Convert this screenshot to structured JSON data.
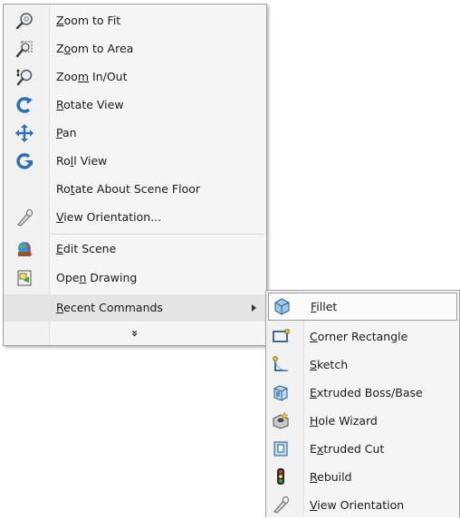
{
  "context_menu": {
    "items": [
      {
        "pre": "",
        "u": "Z",
        "post": "oom to Fit",
        "icon": "zoom-to-fit-icon"
      },
      {
        "pre": "Z",
        "u": "o",
        "post": "om to Area",
        "icon": "zoom-to-area-icon"
      },
      {
        "pre": "Zoo",
        "u": "m",
        "post": " In/Out",
        "icon": "zoom-in-out-icon"
      },
      {
        "pre": "",
        "u": "R",
        "post": "otate View",
        "icon": "rotate-view-icon"
      },
      {
        "pre": "",
        "u": "P",
        "post": "an",
        "icon": "pan-icon"
      },
      {
        "pre": "Ro",
        "u": "l",
        "post": "l View",
        "icon": "roll-view-icon"
      },
      {
        "pre": "Ro",
        "u": "t",
        "post": "ate About Scene Floor",
        "icon": ""
      },
      {
        "pre": "",
        "u": "V",
        "post": "iew Orientation...",
        "icon": "view-orientation-icon"
      },
      {
        "pre": "",
        "u": "E",
        "post": "dit Scene",
        "icon": "edit-scene-icon"
      },
      {
        "pre": "Ope",
        "u": "n",
        "post": " Drawing",
        "icon": "open-drawing-icon"
      },
      {
        "pre": "",
        "u": "R",
        "post": "ecent Commands",
        "icon": ""
      }
    ],
    "more_glyph": "»"
  },
  "submenu": {
    "items": [
      {
        "pre": "",
        "u": "F",
        "post": "illet",
        "icon": "fillet-icon"
      },
      {
        "pre": "",
        "u": "C",
        "post": "orner Rectangle",
        "icon": "corner-rectangle-icon"
      },
      {
        "pre": "",
        "u": "S",
        "post": "ketch",
        "icon": "sketch-icon"
      },
      {
        "pre": "",
        "u": "E",
        "post": "xtruded Boss/Base",
        "icon": "extruded-boss-icon"
      },
      {
        "pre": "",
        "u": "H",
        "post": "ole Wizard",
        "icon": "hole-wizard-icon"
      },
      {
        "pre": "E",
        "u": "x",
        "post": "truded Cut",
        "icon": "extruded-cut-icon"
      },
      {
        "pre": "",
        "u": "R",
        "post": "ebuild",
        "icon": "rebuild-icon"
      },
      {
        "pre": "",
        "u": "V",
        "post": "iew Orientation",
        "icon": "view-orientation-icon"
      }
    ]
  }
}
